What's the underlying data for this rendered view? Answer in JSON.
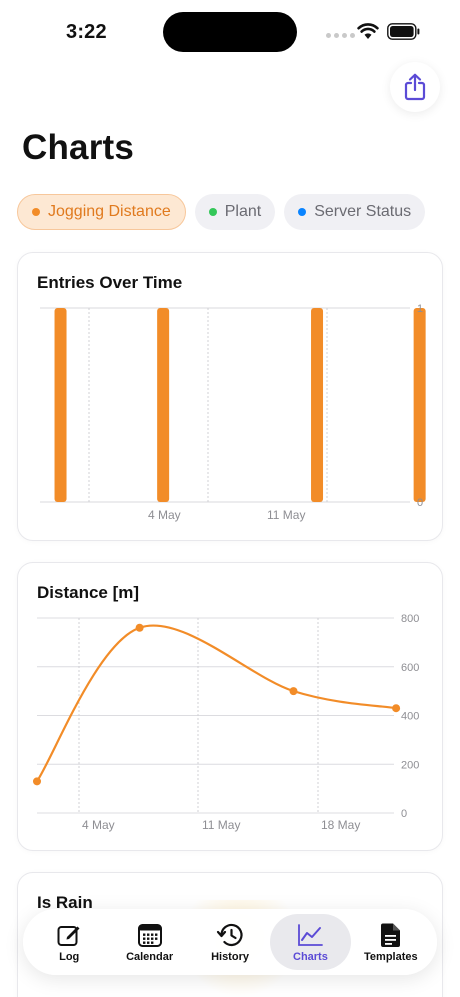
{
  "status_bar": {
    "time": "3:22"
  },
  "header": {
    "title": "Charts",
    "share_icon": "share-icon"
  },
  "chips": [
    {
      "label": "Jogging Distance",
      "color": "#f28c28",
      "active": true
    },
    {
      "label": "Plant",
      "color": "#34c759",
      "active": false
    },
    {
      "label": "Server Status",
      "color": "#0a84ff",
      "active": false
    }
  ],
  "entries_card": {
    "title": "Entries Over Time",
    "chart_data": {
      "type": "bar",
      "x": [
        "2025-04-29",
        "2025-05-05",
        "2025-05-14",
        "2025-05-20"
      ],
      "values": [
        1,
        1,
        1,
        1
      ],
      "ylim": [
        0,
        1
      ],
      "y_ticks": [
        "0",
        "1"
      ],
      "x_tick_labels": [
        "4 May",
        "11 May"
      ],
      "color": "#f28c28",
      "grid": true
    }
  },
  "distance_card": {
    "title": "Distance [m]",
    "chart_data": {
      "type": "line",
      "x": [
        "2025-04-29",
        "2025-05-05",
        "2025-05-14",
        "2025-05-20"
      ],
      "values": [
        130,
        760,
        500,
        430
      ],
      "ylim": [
        0,
        800
      ],
      "y_ticks": [
        "0",
        "200",
        "400",
        "600",
        "800"
      ],
      "x_tick_labels": [
        "4 May",
        "11 May",
        "18 May"
      ],
      "color": "#f28c28",
      "grid": true
    }
  },
  "rain_card": {
    "title": "Is Rain"
  },
  "tabs": [
    {
      "label": "Log",
      "icon": "log-edit-icon",
      "active": false
    },
    {
      "label": "Calendar",
      "icon": "calendar-icon",
      "active": false
    },
    {
      "label": "History",
      "icon": "history-icon",
      "active": false
    },
    {
      "label": "Charts",
      "icon": "chart-line-icon",
      "active": true
    },
    {
      "label": "Templates",
      "icon": "document-icon",
      "active": false
    }
  ]
}
